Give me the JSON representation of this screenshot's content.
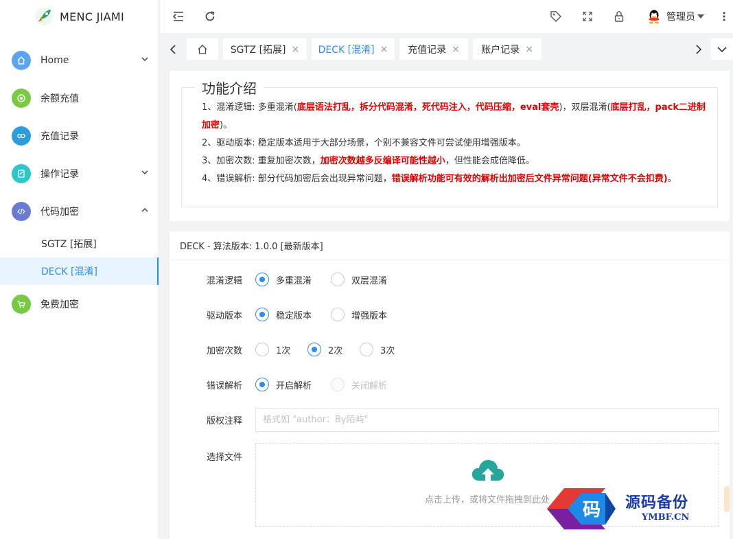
{
  "brand": {
    "name": "MENC JIAMI"
  },
  "sidebar": {
    "items": [
      {
        "label": "Home",
        "icon": "home-icon",
        "color": "#5aa4f7",
        "chevron": "down"
      },
      {
        "label": "余额充值",
        "icon": "recharge-icon",
        "color": "#7ac943"
      },
      {
        "label": "充值记录",
        "icon": "record-icon",
        "color": "#2d9cdb"
      },
      {
        "label": "操作记录",
        "icon": "operation-icon",
        "color": "#2ec7c9",
        "chevron": "down"
      },
      {
        "label": "代码加密",
        "icon": "code-icon",
        "color": "#6b7bd3",
        "chevron": "up"
      },
      {
        "label": "免费加密",
        "icon": "cart-icon",
        "color": "#7ac943"
      }
    ],
    "submenu": [
      {
        "label": "SGTZ [拓展]"
      },
      {
        "label": "DECK [混淆]"
      }
    ]
  },
  "header": {
    "user": "管理员"
  },
  "tabs": [
    {
      "label": "SGTZ [拓展]"
    },
    {
      "label": "DECK [混淆]"
    },
    {
      "label": "充值记录"
    },
    {
      "label": "账户记录"
    }
  ],
  "intro": {
    "title": "功能介绍",
    "l1_a": "1、混淆逻辑: 多重混淆(",
    "l1_red": "底层语法打乱，拆分代码混淆，死代码注入，代码压缩，eval套壳",
    "l1_b": ")，双层混淆(",
    "l1_red2": "底层打乱，pack二进制加密",
    "l1_c": ")。",
    "l2": "2、驱动版本: 稳定版本适用于大部分场景，个别不兼容文件可尝试使用增强版本。",
    "l3_a": "3、加密次数: 重复加密次数，",
    "l3_red": "加密次数越多反编译可能性越小",
    "l3_b": "，但性能会成倍降低。",
    "l4_a": "4、错误解析: 部分代码加密后会出现异常问题，",
    "l4_red": "错误解析功能可有效的解析出加密后文件异常问题(异常文件不会扣费)",
    "l4_b": "。"
  },
  "form": {
    "header": "DECK - 算法版本: 1.0.0 [最新版本]",
    "obf_label": "混淆逻辑",
    "obf_opt1": "多重混淆",
    "obf_opt2": "双层混淆",
    "drv_label": "驱动版本",
    "drv_opt1": "稳定版本",
    "drv_opt2": "增强版本",
    "cnt_label": "加密次数",
    "cnt_opt1": "1次",
    "cnt_opt2": "2次",
    "cnt_opt3": "3次",
    "err_label": "错误解析",
    "err_opt1": "开启解析",
    "err_opt2": "关闭解析",
    "copyright_label": "版权注释",
    "copyright_placeholder": "格式如 \"author：By陌屿\"",
    "file_label": "选择文件",
    "upload_text": "点击上传，或将文件拖拽到此处",
    "upload_color": "#26a69a"
  },
  "watermark": {
    "cn": "源码备份",
    "en": "YMBF.CN",
    "glyph": "码"
  }
}
